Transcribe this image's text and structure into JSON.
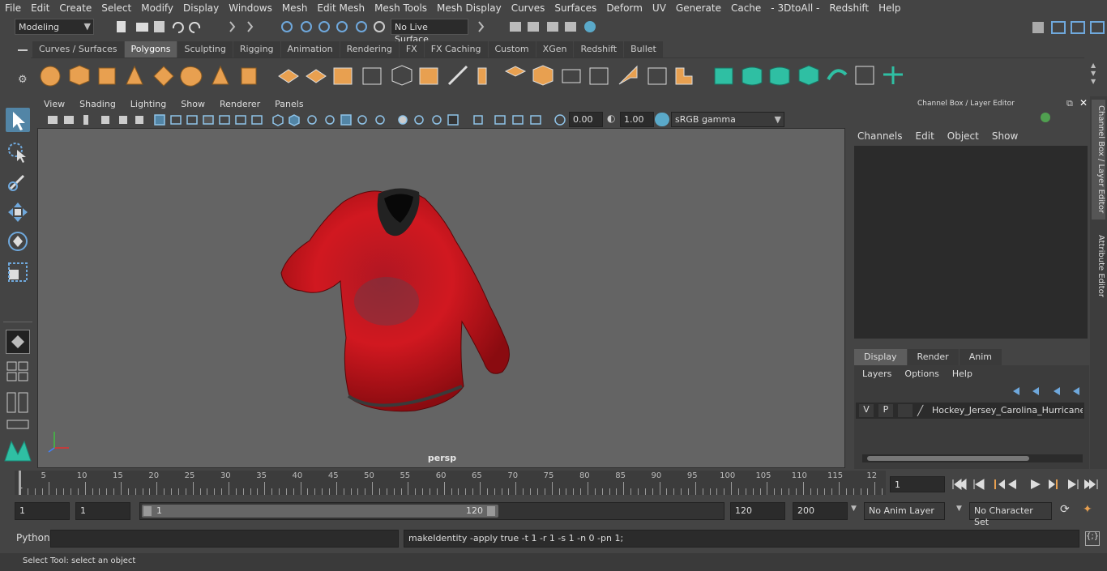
{
  "menubar": {
    "items": [
      "File",
      "Edit",
      "Create",
      "Select",
      "Modify",
      "Display",
      "Windows",
      "Mesh",
      "Edit Mesh",
      "Mesh Tools",
      "Mesh Display",
      "Curves",
      "Surfaces",
      "Deform",
      "UV",
      "Generate",
      "Cache",
      "- 3DtoAll -",
      "Redshift",
      "Help"
    ]
  },
  "toolbar": {
    "mode": "Modeling",
    "live_surface": "No Live Surface"
  },
  "shelf": {
    "tabs": [
      "Curves / Surfaces",
      "Polygons",
      "Sculpting",
      "Rigging",
      "Animation",
      "Rendering",
      "FX",
      "FX Caching",
      "Custom",
      "XGen",
      "Redshift",
      "Bullet"
    ],
    "active_tab": "Polygons"
  },
  "viewport": {
    "menu": [
      "View",
      "Shading",
      "Lighting",
      "Show",
      "Renderer",
      "Panels"
    ],
    "exposure": "0.00",
    "gamma": "1.00",
    "color_space": "sRGB gamma",
    "camera": "persp"
  },
  "channel_box": {
    "title": "Channel Box / Layer Editor",
    "menu": [
      "Channels",
      "Edit",
      "Object",
      "Show"
    ],
    "tabs": [
      "Display",
      "Render",
      "Anim"
    ],
    "active_tab": "Display",
    "layer_menu": [
      "Layers",
      "Options",
      "Help"
    ],
    "layer": {
      "v": "V",
      "p": "P",
      "name": "Hockey_Jersey_Carolina_Hurricanes_l"
    }
  },
  "right_tabs": [
    "Channel Box / Layer Editor",
    "Attribute Editor"
  ],
  "timeline": {
    "labels": [
      "5",
      "10",
      "15",
      "20",
      "25",
      "30",
      "35",
      "40",
      "45",
      "50",
      "55",
      "60",
      "65",
      "70",
      "75",
      "80",
      "85",
      "90",
      "95",
      "100",
      "105",
      "110",
      "115",
      "12"
    ],
    "first": "1",
    "current_frame": "1"
  },
  "range": {
    "start": "1",
    "playback_start": "1",
    "slider_start": "1",
    "slider_end": "120",
    "playback_end": "120",
    "end": "200",
    "anim_layer": "No Anim Layer",
    "character_set": "No Character Set"
  },
  "command": {
    "lang": "Python",
    "input": "",
    "result": "makeIdentity -apply true -t 1 -r 1 -s 1 -n 0 -pn 1;"
  },
  "help": "Select Tool: select an object",
  "colors": {
    "accent": "#5285a6",
    "icon_orange": "#e8a050",
    "icon_teal": "#2fbfa3",
    "jersey": "#c8141c"
  }
}
